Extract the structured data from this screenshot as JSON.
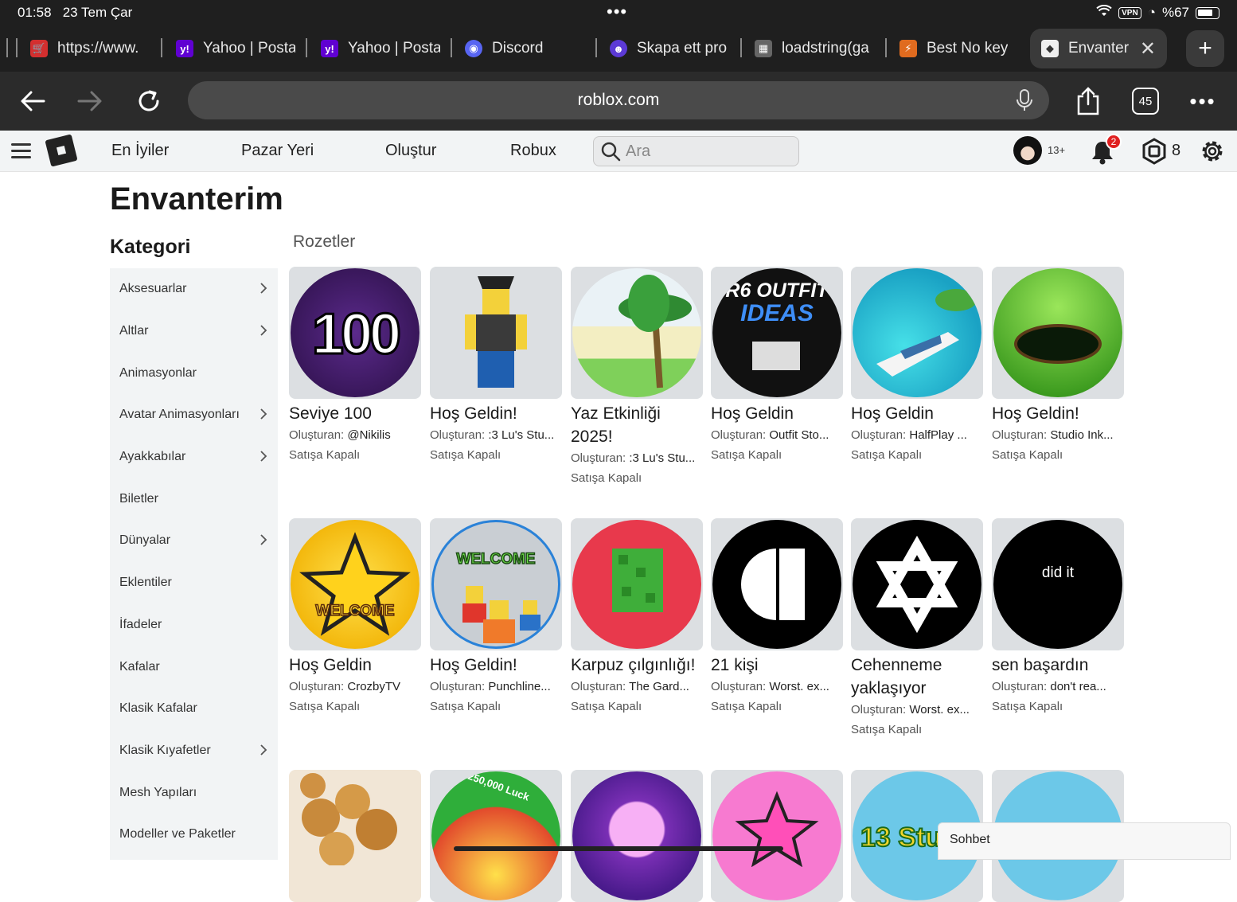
{
  "status_bar": {
    "time": "01:58",
    "date": "23 Tem Çar",
    "vpn": "VPN",
    "battery": "%67"
  },
  "tabs": [
    {
      "title": "https://www.",
      "fav": "🛒",
      "color": "#d32f2f"
    },
    {
      "title": "Yahoo | Posta",
      "fav": "y!",
      "color": "#6001d2"
    },
    {
      "title": "Yahoo | Posta",
      "fav": "y!",
      "color": "#6001d2"
    },
    {
      "title": "Discord",
      "fav": "◉",
      "color": "#5865f2"
    },
    {
      "title": "Skapa ett pro",
      "fav": "☻",
      "color": "#5c3ad6"
    },
    {
      "title": "loadstring(ga",
      "fav": "▦",
      "color": "#666"
    },
    {
      "title": "Best No key",
      "fav": "⚡",
      "color": "#e06b1f"
    },
    {
      "title": "Envanter",
      "fav": "◆",
      "color": "#555"
    }
  ],
  "toolbar": {
    "url": "roblox.com",
    "tab_count": "45"
  },
  "nav": {
    "links": [
      "En İyiler",
      "Pazar Yeri",
      "Oluştur",
      "Robux"
    ],
    "search_placeholder": "Ara",
    "age": "13+",
    "notifications": "2",
    "robux": "8"
  },
  "page": {
    "title": "Envanterim",
    "category_heading": "Kategori",
    "section": "Rozetler"
  },
  "categories": [
    {
      "label": "Aksesuarlar",
      "chevron": true
    },
    {
      "label": "Altlar",
      "chevron": true
    },
    {
      "label": "Animasyonlar",
      "chevron": false
    },
    {
      "label": "Avatar Animasyonları",
      "chevron": true
    },
    {
      "label": "Ayakkabılar",
      "chevron": true
    },
    {
      "label": "Biletler",
      "chevron": false
    },
    {
      "label": "Dünyalar",
      "chevron": true
    },
    {
      "label": "Eklentiler",
      "chevron": false
    },
    {
      "label": "İfadeler",
      "chevron": false
    },
    {
      "label": "Kafalar",
      "chevron": false
    },
    {
      "label": "Klasik Kafalar",
      "chevron": false
    },
    {
      "label": "Klasik Kıyafetler",
      "chevron": true
    },
    {
      "label": "Mesh Yapıları",
      "chevron": false
    },
    {
      "label": "Modeller ve Paketler",
      "chevron": false
    }
  ],
  "creator_label": "Oluşturan:",
  "badges": [
    {
      "name": "Seviye 100",
      "creator": "@Nikilis",
      "status": "Satışa Kapalı",
      "art": "100"
    },
    {
      "name": "Hoş Geldin!",
      "creator": ":3 Lu's Stu...",
      "status": "Satışa Kapalı",
      "art": "pirate"
    },
    {
      "name": "Yaz Etkinliği 2025!",
      "creator": ":3 Lu's Stu...",
      "status": "Satışa Kapalı",
      "art": "beach"
    },
    {
      "name": "Hoş Geldin",
      "creator": "Outfit Sto...",
      "status": "Satışa Kapalı",
      "art": "r6"
    },
    {
      "name": "Hoş Geldin",
      "creator": "HalfPlay ...",
      "status": "Satışa Kapalı",
      "art": "boat"
    },
    {
      "name": "Hoş Geldin!",
      "creator": "Studio Ink...",
      "status": "Satışa Kapalı",
      "art": "hole"
    },
    {
      "name": "Hoş Geldin",
      "creator": "CrozbyTV",
      "status": "Satışa Kapalı",
      "art": "star"
    },
    {
      "name": "Hoş Geldin!",
      "creator": "Punchline...",
      "status": "Satışa Kapalı",
      "art": "elevator"
    },
    {
      "name": "Karpuz çılgınlığı!",
      "creator": "The Gard...",
      "status": "Satışa Kapalı",
      "art": "melon"
    },
    {
      "name": "21 kişi",
      "creator": "Worst. ex...",
      "status": "Satışa Kapalı",
      "art": "face"
    },
    {
      "name": "Cehenneme yaklaşıyor",
      "creator": "Worst. ex...",
      "status": "Satışa Kapalı",
      "art": "hexstar"
    },
    {
      "name": "sen başardın",
      "creator": "don't rea...",
      "status": "Satışa Kapalı",
      "art": "didit"
    }
  ],
  "badge_art_text": {
    "r6_line1": "R6 OUTFIT",
    "r6_line2": "IDEAS",
    "welcome": "WELCOME",
    "did_it": "did it",
    "hundred": "100",
    "luck": "x250,000 Luck",
    "stu": "13 Stu"
  },
  "chat_label": "Sohbet",
  "colors": {
    "chrome": "#1f1f1f",
    "nav_bg": "#f2f4f5",
    "badge_red": "#e02020"
  }
}
